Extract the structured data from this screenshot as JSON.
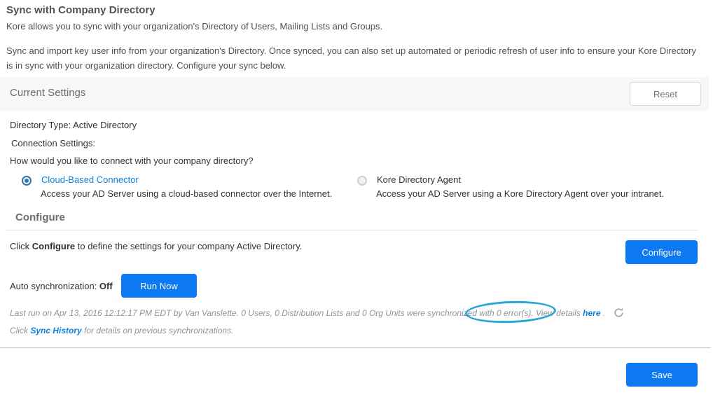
{
  "page": {
    "title": "Sync with Company Directory",
    "intro": "Kore allows you to sync with your organization's Directory of Users, Mailing Lists and Groups.",
    "description": "Sync and import key user info from your organization's Directory. Once synced, you can also set up automated or periodic refresh of user info to ensure your Kore Directory is in sync with your organization directory. Configure your sync below."
  },
  "current_settings": {
    "heading": "Current Settings",
    "reset_button": "Reset",
    "directory_type": "Directory Type: Active Directory",
    "connection_settings_label": "Connection Settings:",
    "question": "How would you like to connect with your company directory?"
  },
  "connectors": [
    {
      "label": "Cloud-Based Connector",
      "description": "Access your AD Server using a cloud-based connector over the Internet.",
      "selected": true
    },
    {
      "label": "Kore Directory Agent",
      "description": "Access your AD Server using a Kore Directory Agent over your intranet.",
      "selected": false
    }
  ],
  "configure": {
    "heading": "Configure",
    "instruction_prefix": "Click ",
    "instruction_bold": "Configure",
    "instruction_suffix": " to define the settings for your company Active Directory.",
    "button": "Configure"
  },
  "auto_sync": {
    "label": "Auto synchronization: ",
    "value": "Off",
    "run_button": "Run Now"
  },
  "last_run": {
    "text": "Last run on Apr 13, 2016 12:12:17 PM EDT by Van Vanslette. 0 Users, 0 Distribution Lists and 0 Org Units were synchronized with 0 error(s). View details ",
    "link": "here",
    "suffix": " ."
  },
  "sync_history": {
    "prefix": "Click ",
    "link": "Sync History",
    "suffix": " for details on previous synchronizations."
  },
  "save_button": "Save",
  "colors": {
    "primary_blue": "#0c78f2",
    "link_blue": "#0d82dc",
    "radio_selected_blue": "#2e76ae",
    "annotation_ellipse_blue": "#2aa5d6",
    "settings_bar_bg": "#f7f7f8"
  }
}
